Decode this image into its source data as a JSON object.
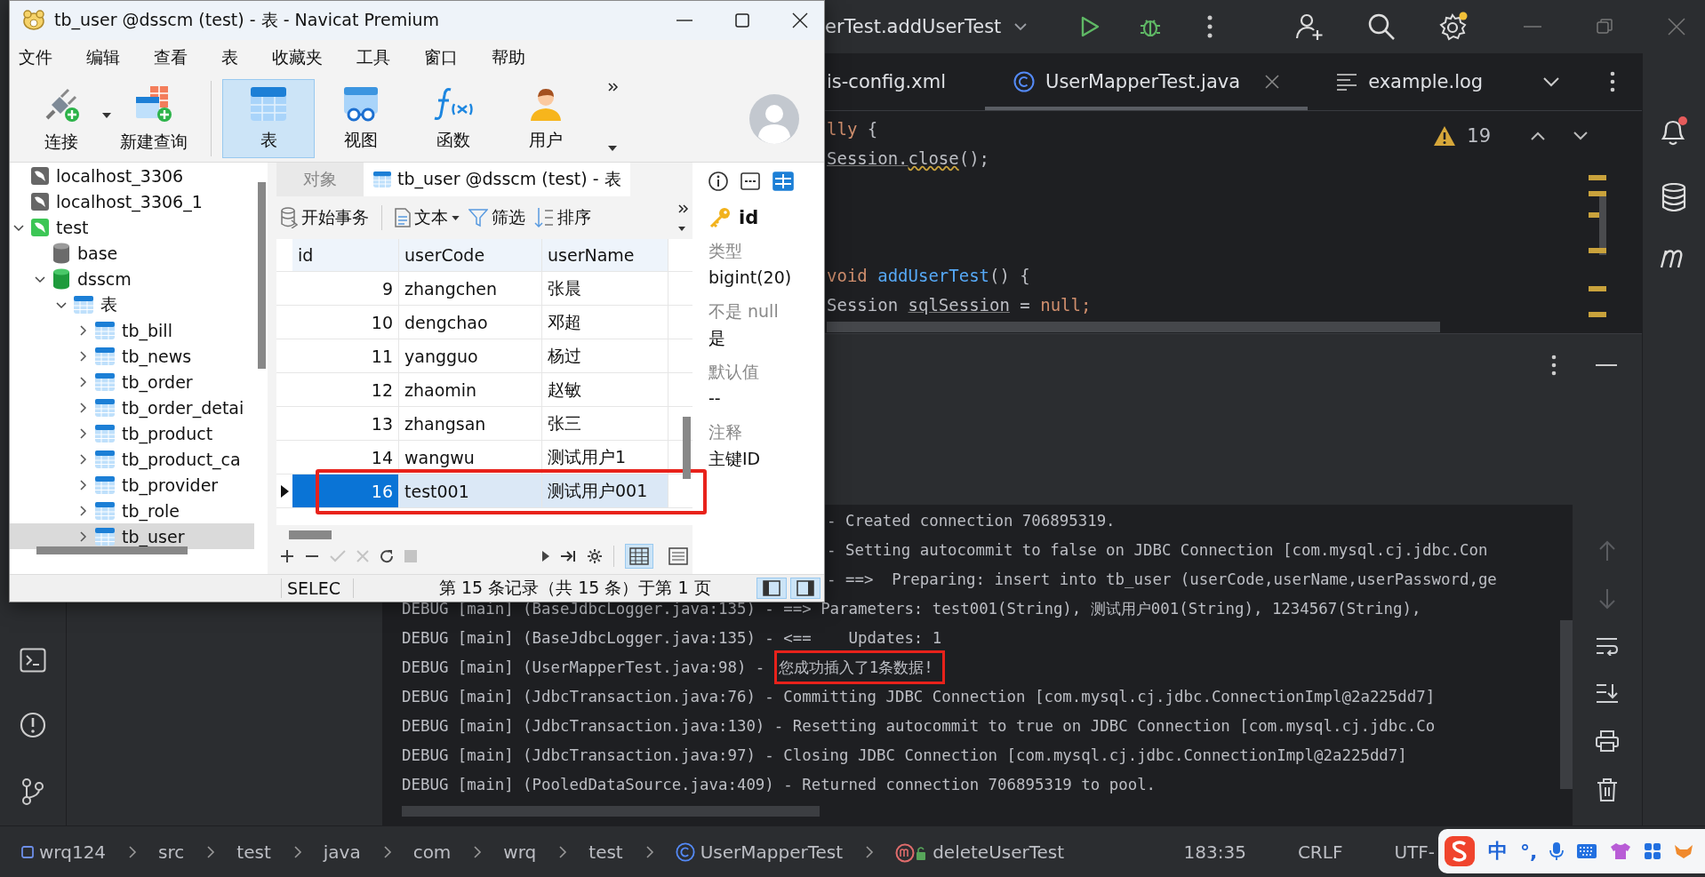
{
  "ide": {
    "run_config": "erTest.addUserTest",
    "editor_tabs": [
      {
        "label": "is-config.xml",
        "kind": "partial",
        "selected": false
      },
      {
        "label": "UserMapperTest.java",
        "kind": "class",
        "selected": true
      },
      {
        "label": "example.log",
        "kind": "log",
        "selected": false
      }
    ],
    "warning_count": "19",
    "code_blocks": [
      [
        {
          "segments": [
            {
              "text": "lly",
              "kind": "keyword"
            },
            {
              "text": " {",
              "kind": "plain"
            }
          ]
        },
        {
          "segments": [
            {
              "text": "Session.",
              "kind": "underline"
            },
            {
              "text": "close",
              "kind": "squiggle"
            },
            {
              "text": "();",
              "kind": "plain"
            }
          ]
        }
      ],
      [
        {
          "segments": [
            {
              "text": "void ",
              "kind": "keyword"
            },
            {
              "text": "addUserTest",
              "kind": "method"
            },
            {
              "text": "() {",
              "kind": "plain"
            }
          ]
        },
        {
          "segments": [
            {
              "text": "Session ",
              "kind": "plain"
            },
            {
              "text": "sqlSession",
              "kind": "underline"
            },
            {
              "text": " = ",
              "kind": "plain"
            },
            {
              "text": "null;",
              "kind": "keyword"
            }
          ]
        }
      ]
    ],
    "console_lines": [
      {
        "text": "- Created connection 706895319.",
        "kind": "partial",
        "boxed": false
      },
      {
        "text": "- Setting autocommit to false on JDBC Connection [com.mysql.cj.jdbc.Con",
        "kind": "partial",
        "boxed": false
      },
      {
        "text": "- ==>  Preparing: insert into tb_user (userCode,userName,userPassword,ge",
        "kind": "partial",
        "boxed": false
      },
      {
        "text": "DEBUG [main] (BaseJdbcLogger.java:135) - ==> Parameters: test001(String), 测试用户001(String), 1234567(String),",
        "kind": "full",
        "boxed": false
      },
      {
        "text": "DEBUG [main] (BaseJdbcLogger.java:135) - <==    Updates: 1",
        "kind": "full",
        "boxed": false
      },
      {
        "text": "DEBUG [main] (UserMapperTest.java:98) - ",
        "message": "您成功插入了1条数据!",
        "kind": "full",
        "boxed": true
      },
      {
        "text": "DEBUG [main] (JdbcTransaction.java:76) - Committing JDBC Connection [com.mysql.cj.jdbc.ConnectionImpl@2a225dd7]",
        "kind": "full",
        "boxed": false
      },
      {
        "text": "DEBUG [main] (JdbcTransaction.java:130) - Resetting autocommit to true on JDBC Connection [com.mysql.cj.jdbc.Co",
        "kind": "full",
        "boxed": false
      },
      {
        "text": "DEBUG [main] (JdbcTransaction.java:97) - Closing JDBC Connection [com.mysql.cj.jdbc.ConnectionImpl@2a225dd7]",
        "kind": "full",
        "boxed": false
      },
      {
        "text": "DEBUG [main] (PooledDataSource.java:409) - Returned connection 706895319 to pool.",
        "kind": "full",
        "boxed": false
      }
    ],
    "console_tools": [
      {
        "kind": "up",
        "disabled": true
      },
      {
        "kind": "down",
        "disabled": true
      },
      {
        "kind": "wrap",
        "disabled": false
      },
      {
        "kind": "scroll-end",
        "disabled": false
      },
      {
        "kind": "print",
        "disabled": false
      },
      {
        "kind": "delete",
        "disabled": false
      }
    ],
    "breadcrumbs": [
      {
        "label": "wrq124",
        "kind": "module"
      },
      {
        "label": "src",
        "kind": "folder"
      },
      {
        "label": "test",
        "kind": "folder"
      },
      {
        "label": "java",
        "kind": "folder"
      },
      {
        "label": "com",
        "kind": "folder"
      },
      {
        "label": "wrq",
        "kind": "folder"
      },
      {
        "label": "test",
        "kind": "folder"
      },
      {
        "label": "UserMapperTest",
        "kind": "class"
      },
      {
        "label": "deleteUserTest",
        "kind": "method"
      }
    ],
    "status_items": [
      "183:35",
      "CRLF",
      "UTF-"
    ],
    "ime": {
      "mode": "中",
      "punctuation": "°,"
    }
  },
  "navicat": {
    "window": {
      "title": "tb_user @dsscm (test) - 表 - Navicat Premium"
    },
    "menu": [
      "文件",
      "编辑",
      "查看",
      "表",
      "收藏夹",
      "工具",
      "窗口",
      "帮助"
    ],
    "toolbar": [
      {
        "label": "连接",
        "kind": "connect",
        "dropdown": true,
        "selected": false
      },
      {
        "label": "新建查询",
        "kind": "query",
        "dropdown": false,
        "selected": false
      },
      {
        "label": "表",
        "kind": "table",
        "dropdown": false,
        "selected": true
      },
      {
        "label": "视图",
        "kind": "view",
        "dropdown": false,
        "selected": false
      },
      {
        "label": "函数",
        "kind": "function",
        "dropdown": false,
        "selected": false
      },
      {
        "label": "用户",
        "kind": "user",
        "dropdown": false,
        "selected": false
      }
    ],
    "tree": [
      {
        "label": "localhost_3306",
        "kind": "connection",
        "open": false,
        "selected": false
      },
      {
        "label": "localhost_3306_1",
        "kind": "connection",
        "open": false,
        "selected": false
      },
      {
        "label": "test",
        "kind": "connection",
        "open": true,
        "expanded": true,
        "selected": false,
        "children": [
          {
            "label": "base",
            "kind": "database",
            "open": false,
            "selected": false
          },
          {
            "label": "dsscm",
            "kind": "database",
            "open": true,
            "expanded": true,
            "selected": false,
            "children": [
              {
                "label": "表",
                "kind": "group",
                "expanded": true,
                "selected": false,
                "children": [
                  {
                    "label": "tb_bill",
                    "kind": "table",
                    "expanded": false,
                    "selected": false
                  },
                  {
                    "label": "tb_news",
                    "kind": "table",
                    "expanded": false,
                    "selected": false
                  },
                  {
                    "label": "tb_order",
                    "kind": "table",
                    "expanded": false,
                    "selected": false
                  },
                  {
                    "label": "tb_order_detai",
                    "kind": "table",
                    "expanded": false,
                    "selected": false
                  },
                  {
                    "label": "tb_product",
                    "kind": "table",
                    "expanded": false,
                    "selected": false
                  },
                  {
                    "label": "tb_product_ca",
                    "kind": "table",
                    "expanded": false,
                    "selected": false
                  },
                  {
                    "label": "tb_provider",
                    "kind": "table",
                    "expanded": false,
                    "selected": false
                  },
                  {
                    "label": "tb_role",
                    "kind": "table",
                    "expanded": false,
                    "selected": false
                  },
                  {
                    "label": "tb_user",
                    "kind": "table",
                    "expanded": false,
                    "selected": true
                  }
                ]
              }
            ]
          }
        ]
      }
    ],
    "tabs": [
      {
        "label": "对象",
        "kind": "objects",
        "selected": false
      },
      {
        "label": "tb_user @dsscm (test) - 表",
        "kind": "table",
        "selected": true
      }
    ],
    "data_toolbar": [
      {
        "label": "开始事务",
        "kind": "transaction",
        "dropdown": false
      },
      {
        "label": "文本",
        "kind": "text",
        "dropdown": true
      },
      {
        "label": "筛选",
        "kind": "filter",
        "dropdown": false
      },
      {
        "label": "排序",
        "kind": "sort",
        "dropdown": false
      }
    ],
    "table": {
      "columns": [
        "id",
        "userCode",
        "userName"
      ],
      "rows": [
        {
          "cells": [
            "9",
            "zhangchen",
            "张晨"
          ],
          "selected": false,
          "boxed": false
        },
        {
          "cells": [
            "10",
            "dengchao",
            "邓超"
          ],
          "selected": false,
          "boxed": false
        },
        {
          "cells": [
            "11",
            "yangguo",
            "杨过"
          ],
          "selected": false,
          "boxed": false
        },
        {
          "cells": [
            "12",
            "zhaomin",
            "赵敏"
          ],
          "selected": false,
          "boxed": false
        },
        {
          "cells": [
            "13",
            "zhangsan",
            "张三"
          ],
          "selected": false,
          "boxed": false
        },
        {
          "cells": [
            "14",
            "wangwu",
            "测试用户1"
          ],
          "selected": false,
          "boxed": false
        },
        {
          "cells": [
            "16",
            "test001",
            "测试用户001"
          ],
          "selected": true,
          "boxed": true
        }
      ]
    },
    "grid_tools": [
      {
        "kind": "add",
        "disabled": false
      },
      {
        "kind": "remove",
        "disabled": false
      },
      {
        "kind": "apply",
        "disabled": true
      },
      {
        "kind": "discard",
        "disabled": true
      },
      {
        "kind": "refresh",
        "disabled": false
      },
      {
        "kind": "stop",
        "disabled": true
      }
    ],
    "view_modes": [
      {
        "kind": "grid",
        "selected": true
      },
      {
        "kind": "form",
        "selected": false
      }
    ],
    "info_tabs": [
      {
        "kind": "info",
        "selected": false
      },
      {
        "kind": "ddl",
        "selected": false
      },
      {
        "kind": "fields",
        "selected": true
      }
    ],
    "field": {
      "name": "id",
      "properties": [
        {
          "label": "类型",
          "value": "bigint(20)"
        },
        {
          "label": "不是 null",
          "value": "是"
        },
        {
          "label": "默认值",
          "value": "--"
        },
        {
          "label": "注释",
          "value": "主键ID"
        }
      ]
    },
    "status": {
      "mode": "SELEC",
      "record": "第 15 条记录（共 15 条）于第 1 页"
    }
  }
}
